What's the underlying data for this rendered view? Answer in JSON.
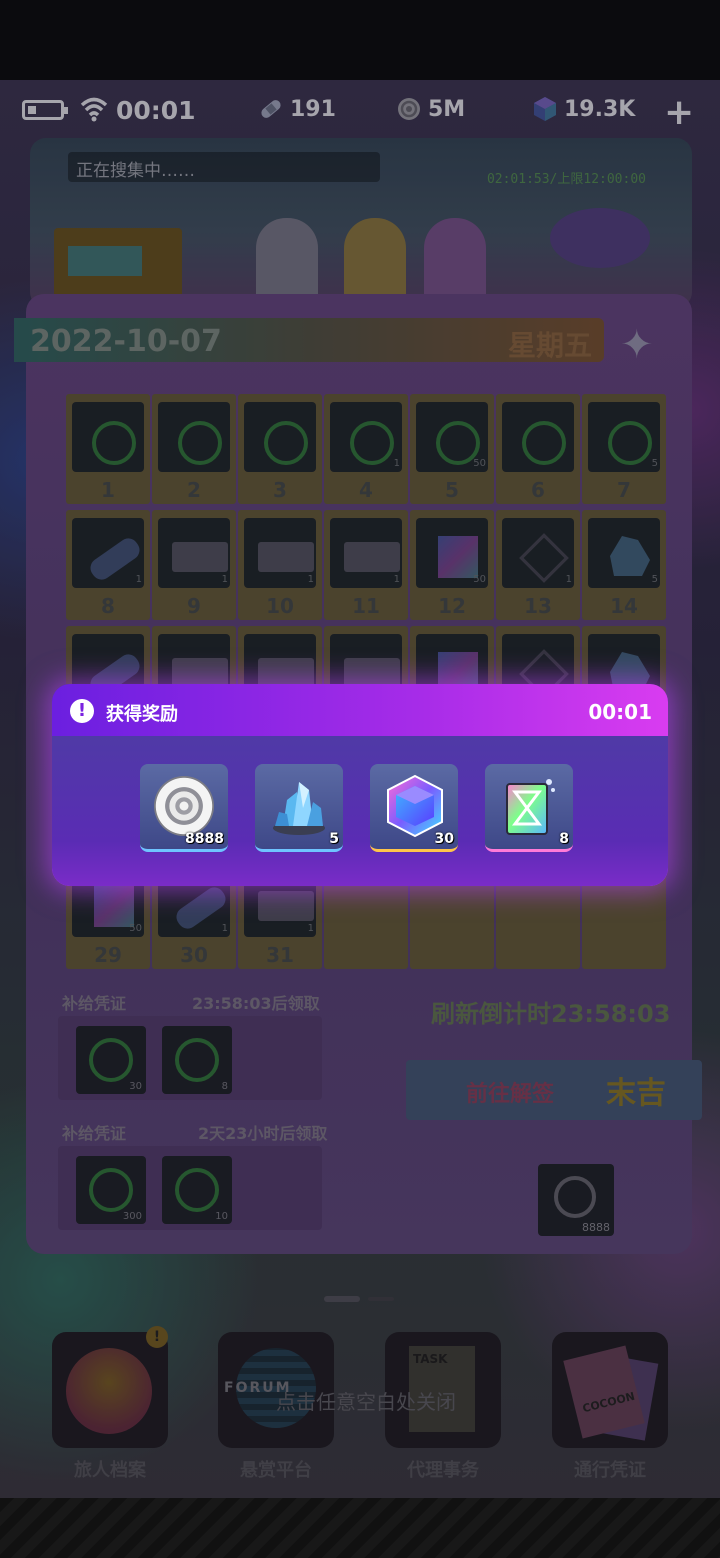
{
  "status_bar": {
    "time": "00:01",
    "currencies": [
      {
        "icon": "bandage-icon",
        "value": "191"
      },
      {
        "icon": "coin-icon",
        "value": "5M"
      },
      {
        "icon": "cube-icon",
        "value": "19.3K"
      }
    ],
    "add_label": "+"
  },
  "banner": {
    "search_status": "正在搜集中……",
    "timer": "02:01:53/上限12:00:00"
  },
  "calendar": {
    "date": "2022-10-07",
    "weekday": "星期五",
    "days": [
      {
        "num": "1",
        "qty": "",
        "icon": "ring"
      },
      {
        "num": "2",
        "qty": "",
        "icon": "ring"
      },
      {
        "num": "3",
        "qty": "",
        "icon": "ring"
      },
      {
        "num": "4",
        "qty": "1",
        "icon": "ring"
      },
      {
        "num": "5",
        "qty": "50",
        "icon": "ring"
      },
      {
        "num": "6",
        "qty": "",
        "icon": "ring"
      },
      {
        "num": "7",
        "qty": "5",
        "icon": "ring"
      },
      {
        "num": "8",
        "qty": "1",
        "icon": "stick"
      },
      {
        "num": "9",
        "qty": "1",
        "icon": "ticket"
      },
      {
        "num": "10",
        "qty": "1",
        "icon": "ticket"
      },
      {
        "num": "11",
        "qty": "1",
        "icon": "ticket"
      },
      {
        "num": "12",
        "qty": "50",
        "icon": "cube"
      },
      {
        "num": "13",
        "qty": "1",
        "icon": "tri"
      },
      {
        "num": "14",
        "qty": "5",
        "icon": "crystal"
      },
      {
        "num": "",
        "qty": "",
        "icon": "stick"
      },
      {
        "num": "",
        "qty": "",
        "icon": "ticket"
      },
      {
        "num": "",
        "qty": "",
        "icon": "ticket"
      },
      {
        "num": "",
        "qty": "",
        "icon": "ticket"
      },
      {
        "num": "",
        "qty": "",
        "icon": "cube"
      },
      {
        "num": "",
        "qty": "",
        "icon": "tri"
      },
      {
        "num": "",
        "qty": "",
        "icon": "crystal"
      },
      {
        "num": "29",
        "qty": "50",
        "icon": "cube"
      },
      {
        "num": "30",
        "qty": "1",
        "icon": "stick"
      },
      {
        "num": "31",
        "qty": "1",
        "icon": "ticket"
      },
      {
        "num": "",
        "qty": "",
        "icon": "none"
      },
      {
        "num": "",
        "qty": "",
        "icon": "none"
      },
      {
        "num": "",
        "qty": "",
        "icon": "none"
      },
      {
        "num": "",
        "qty": "",
        "icon": "none"
      }
    ],
    "supplement_1": {
      "label": "补给凭证",
      "timer": "23:58:03后领取",
      "qtys": [
        "30",
        "8"
      ]
    },
    "supplement_2": {
      "label": "补给凭证",
      "timer": "2天23小时后领取",
      "qtys": [
        "300",
        "10"
      ]
    },
    "refresh_countdown": "刷新倒计时23:58:03",
    "goto_label": "前往解签",
    "luck_label": "末吉",
    "coin_qty": "8888"
  },
  "dialog": {
    "title": "获得奖励",
    "timer": "00:01",
    "rewards": [
      {
        "icon": "coin-icon",
        "qty": "8888",
        "accent": "#6fc4ff"
      },
      {
        "icon": "crystal-icon",
        "qty": "5",
        "accent": "#6fc4ff"
      },
      {
        "icon": "cube-icon",
        "qty": "30",
        "accent": "#ffc54a"
      },
      {
        "icon": "hourglass-icon",
        "qty": "8",
        "accent": "#ff7bd8"
      }
    ]
  },
  "dock": {
    "tip": "点击任意空白处关闭",
    "items": [
      {
        "label": "旅人档案",
        "badge": "!"
      },
      {
        "label": "悬赏平台"
      },
      {
        "label": "代理事务"
      },
      {
        "label": "通行凭证"
      }
    ],
    "forum_text": "FORUM",
    "task_text": "TASK",
    "cocoon_text": "COCOON"
  },
  "colors": {
    "dialog_accent": "#a72ce8",
    "dialog_glow": "#be46ff"
  }
}
